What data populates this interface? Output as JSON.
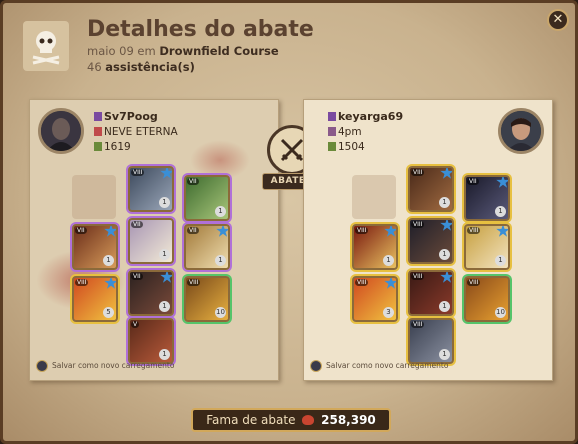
{
  "header": {
    "title": "Detalhes do abate",
    "date": "maio 09 em",
    "location": "Drownfield Course",
    "assist_count": "46",
    "assist_label": "assistência(s)"
  },
  "close_label": "✕",
  "killer": {
    "name": "Sv7Poog",
    "guild": "NEVE ETERNA",
    "power": "1619",
    "save_label": "Salvar como novo carregamento"
  },
  "victim": {
    "name": "keyarga69",
    "guild": "4pm",
    "power": "1504",
    "save_label": "Salvar como novo carregamento"
  },
  "center": {
    "badge": "ABATEU"
  },
  "fame": {
    "label": "Fama de abate",
    "value": "258,390"
  },
  "colors": {
    "accent": "#d2a85a",
    "blood": "#c94530",
    "rarity_blue": "#3a8fd6"
  }
}
